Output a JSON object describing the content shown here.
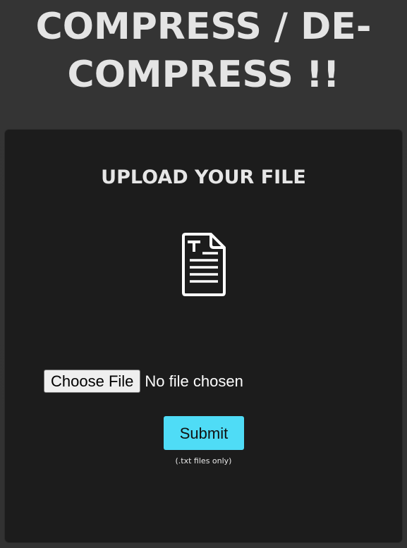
{
  "header": {
    "title_line1": "COMPRESS / DE-",
    "title_line2": "COMPRESS !!"
  },
  "upload_card": {
    "heading": "UPLOAD YOUR FILE",
    "icon": "text-file-icon",
    "file_input": {
      "button_label": "Choose File",
      "status_text": "No file chosen"
    },
    "submit_label": "Submit",
    "hint": "(.txt files only)"
  },
  "colors": {
    "page_background": "#333333",
    "card_background": "#1c1c1c",
    "heading_text": "#e4e4e4",
    "submit_button": "#4fdcf6"
  }
}
